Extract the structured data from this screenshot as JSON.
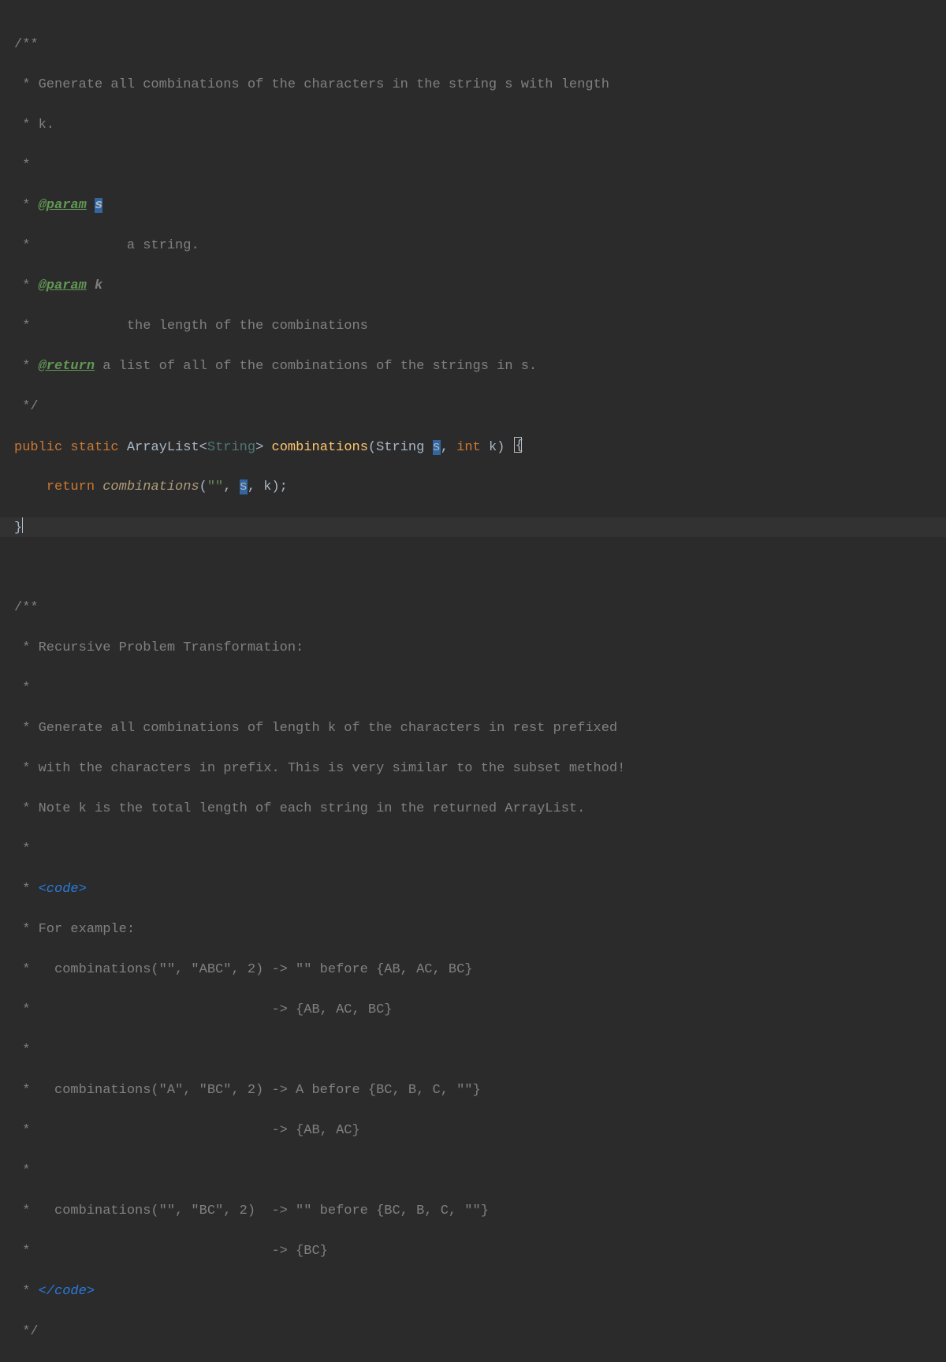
{
  "code": {
    "jdoc1_open": "/**",
    "jdoc1_l1": " * Generate all combinations of the characters in the string s with length",
    "jdoc1_l2": " * k.",
    "jdoc1_l3": " *",
    "jdoc1_p1_star": " * ",
    "jdoc1_p1_tag": "@param",
    "jdoc1_p1_name": " s",
    "jdoc1_p1_desc_star": " *            ",
    "jdoc1_p1_desc": "a string.",
    "jdoc1_p2_star": " * ",
    "jdoc1_p2_tag": "@param",
    "jdoc1_p2_name": " k",
    "jdoc1_p2_desc_star": " *            ",
    "jdoc1_p2_desc": "the length of the combinations",
    "jdoc1_r_star": " * ",
    "jdoc1_r_tag": "@return",
    "jdoc1_r_desc": " a list of all of the combinations of the strings in s.",
    "jdoc1_close": " */",
    "sig_public": "public ",
    "sig_static": "static ",
    "sig_list": "ArrayList",
    "sig_lt": "<",
    "sig_generic": "String",
    "sig_gt": "> ",
    "sig_method": "combinations",
    "sig_open_paren": "(",
    "sig_p1_type": "String ",
    "sig_p1_name": "s",
    "sig_c1": ", ",
    "sig_p2_type": "int ",
    "sig_p2_name": "k",
    "sig_close_paren": ") ",
    "sig_brace": "{",
    "ret_indent": "    ",
    "ret_kw": "return ",
    "ret_call": "combinations",
    "ret_open": "(",
    "ret_a1": "\"\"",
    "ret_c1": ", ",
    "ret_a2": "s",
    "ret_c2": ", ",
    "ret_a3": "k",
    "ret_close": ");",
    "close_brace": "}",
    "blank": "",
    "jdoc2_open": "/**",
    "jdoc2_l1": " * Recursive Problem Transformation:",
    "jdoc2_l2": " *",
    "jdoc2_l3": " * Generate all combinations of length k of the characters in rest prefixed",
    "jdoc2_l4": " * with the characters in prefix. This is very similar to the subset method!",
    "jdoc2_l5": " * Note k is the total length of each string in the returned ArrayList.",
    "jdoc2_l6": " *",
    "jdoc2_code_star": " * ",
    "jdoc2_code_open": "<code>",
    "jdoc2_ex0": " * For example:",
    "jdoc2_ex1a": " *   combinations(\"\", \"ABC\", 2) ",
    "jdoc2_ex1a_arrow": "->",
    "jdoc2_ex1a_rest": " \"\" before {AB, AC, BC}",
    "jdoc2_ex1b": " *                              ",
    "jdoc2_ex1b_arrow": "->",
    "jdoc2_ex1b_rest": " {AB, AC, BC}",
    "jdoc2_star": " *",
    "jdoc2_ex2a": " *   combinations(\"A\", \"BC\", 2) ",
    "jdoc2_ex2a_arrow": "->",
    "jdoc2_ex2a_rest": " A before {BC, B, C, \"\"}",
    "jdoc2_ex2b": " *                              ",
    "jdoc2_ex2b_arrow": "->",
    "jdoc2_ex2b_rest": " {AB, AC}",
    "jdoc2_ex3a": " *   combinations(\"\", \"BC\", 2)  ",
    "jdoc2_ex3a_arrow": "->",
    "jdoc2_ex3a_rest": " \"\" before {BC, B, C, \"\"}",
    "jdoc2_ex3b": " *                              ",
    "jdoc2_ex3b_arrow": "->",
    "jdoc2_ex3b_rest": " {BC}",
    "jdoc2_code_close_star": " * ",
    "jdoc2_code_close": "</code>",
    "jdoc2_close": " */"
  }
}
